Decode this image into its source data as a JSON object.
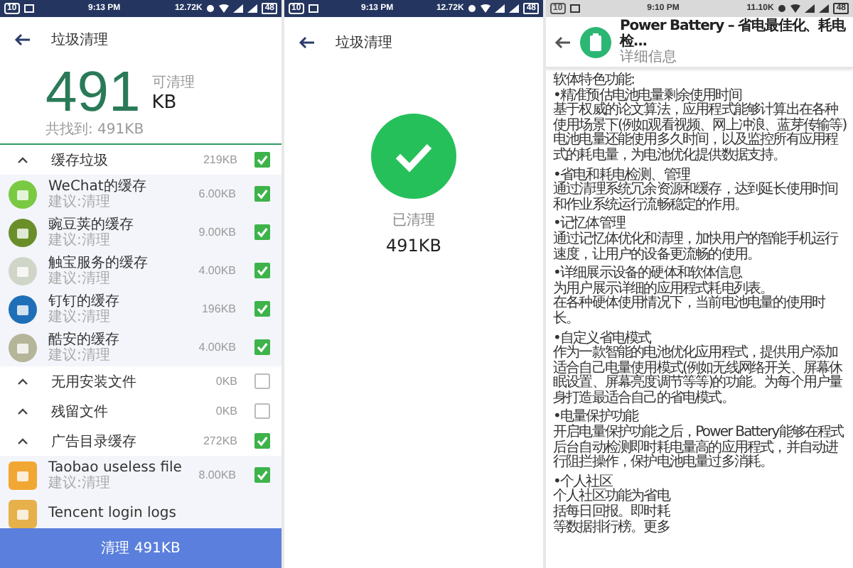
{
  "cleaner": {
    "status_bar": {
      "kind": "dark",
      "badge": "10",
      "time": "9:13 PM",
      "speed": "12.72K",
      "battery": "48"
    },
    "title": "垃圾清理",
    "total": "491",
    "caption": "可清理",
    "unit": "KB",
    "found": "共找到: 491KB",
    "groups": [
      {
        "label": "缓存垃圾",
        "size": "219KB",
        "checked": true,
        "items": [
          {
            "name": "WeChat的缓存",
            "hint": "建议:清理",
            "size": "6.00KB",
            "checked": true
          },
          {
            "name": "豌豆荚的缓存",
            "hint": "建议:清理",
            "size": "9.00KB",
            "checked": true
          },
          {
            "name": "触宝服务的缓存",
            "hint": "建议:清理",
            "size": "4.00KB",
            "checked": true
          },
          {
            "name": "钉钉的缓存",
            "hint": "建议:清理",
            "size": "196KB",
            "checked": true
          },
          {
            "name": "酷安的缓存",
            "hint": "建议:清理",
            "size": "4.00KB",
            "checked": true
          }
        ]
      },
      {
        "label": "无用安装文件",
        "size": "0KB",
        "checked": false
      },
      {
        "label": "残留文件",
        "size": "0KB",
        "checked": false
      },
      {
        "label": "广告目录缓存",
        "size": "272KB",
        "checked": true,
        "items": [
          {
            "name": "Taobao useless file",
            "hint": "建议:清理",
            "size": "8.00KB",
            "checked": true
          },
          {
            "name": "Tencent login logs"
          }
        ]
      }
    ],
    "button": "清理 491KB"
  },
  "cleaned": {
    "status_bar": {
      "kind": "dark",
      "badge": "10",
      "time": "9:13 PM",
      "speed": "12.72K",
      "battery": "48"
    },
    "title": "垃圾清理",
    "caption": "已清理",
    "amount": "491KB"
  },
  "app_detail": {
    "status_bar": {
      "kind": "light",
      "badge": "10",
      "time": "9:10 PM",
      "speed": "11.10K",
      "battery": "48"
    },
    "title": "Power Battery – 省电最佳化、耗电检...",
    "subtitle": "详细信息",
    "intro": "软体特色功能:",
    "sections": [
      {
        "heading": "•精准预估电池电量剩余使用时间",
        "lines": [
          "基于权威的论文算法，应用程式能够计算出在各种使用场景下(例如观看视频、网上冲浪、蓝芽传输等)电池电量还能使用多久时间，以及监控所有应用程式的耗电量，为电池优化提供数据支持。"
        ]
      },
      {
        "heading": "•省电和耗电检测、管理",
        "lines": [
          "通过清理系统冗余资源和缓存，达到延长使用时间和作业系统运行流畅稳定的作用。"
        ]
      },
      {
        "heading": "•记忆体管理",
        "lines": [
          "通过记忆体优化和清理，加快用户的智能手机运行速度，让用户的设备更流畅的使用。"
        ]
      },
      {
        "heading": "•详细展示设备的硬体和软体信息",
        "lines": [
          "为用户展示详细的应用程式耗电列表。",
          "在各种硬体使用情况下，当前电池电量的使用时长。"
        ]
      },
      {
        "heading": "•自定义省电模式",
        "lines": [
          "作为一款智能的电池优化应用程式，提供用户添加适合自己电量使用模式(例如无线网络开关、屏幕休眠设置、屏幕亮度调节等等)的功能。为每个用户量身打造最适合自己的省电模式。"
        ]
      },
      {
        "heading": "•电量保护功能",
        "lines": [
          "开启电量保护功能之后，Power Battery能够在程式后台自动检测即时耗电量高的应用程式，并自动进行阻拦操作，保护电池电量过多消耗。"
        ]
      },
      {
        "heading": "•个人社区",
        "lines": [
          "个人社区功能为省电",
          "括每日回报。即时耗",
          "等数据排行榜。更多"
        ]
      }
    ]
  }
}
